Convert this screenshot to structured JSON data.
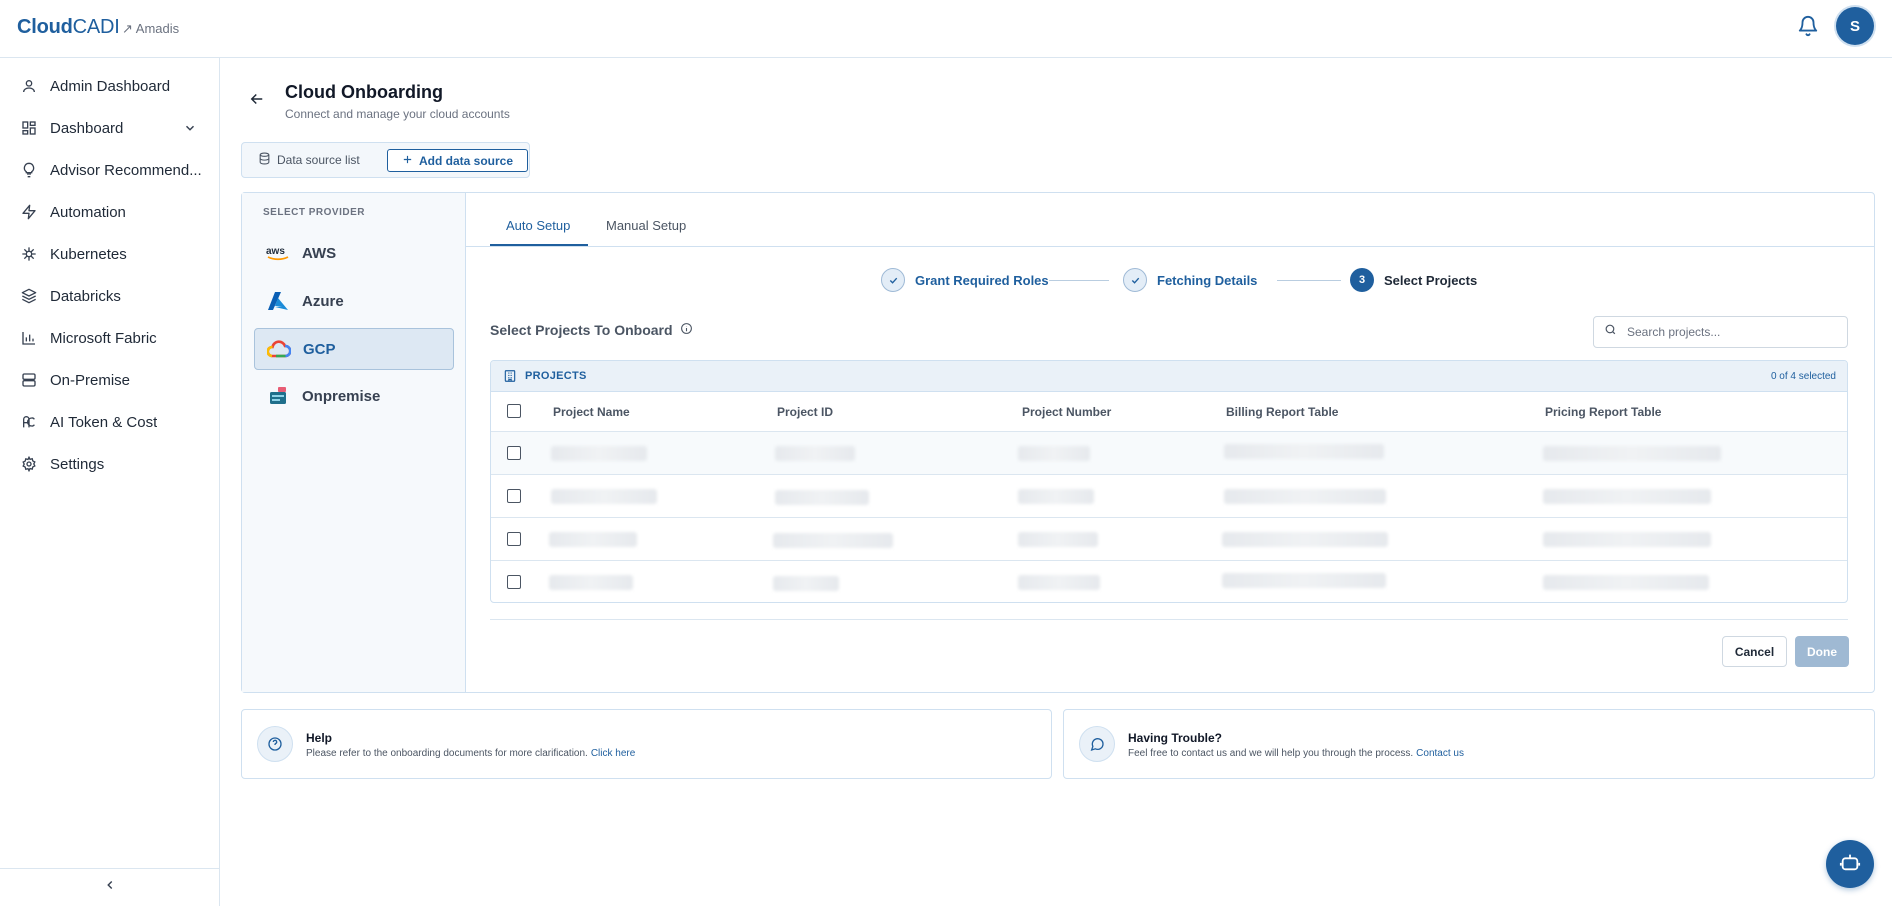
{
  "brand": {
    "logo_bold": "Cloud",
    "logo_rest": "CADI",
    "org": "↗ Amadis",
    "avatar_initial": "S",
    "accent": "#1f5f9e"
  },
  "sidebar": {
    "items": [
      {
        "label": "Admin Dashboard",
        "icon": "user-icon"
      },
      {
        "label": "Dashboard",
        "icon": "grid-icon"
      },
      {
        "label": "Advisor Recommend...",
        "icon": "lightbulb-icon"
      },
      {
        "label": "Automation",
        "icon": "bolt-icon"
      },
      {
        "label": "Kubernetes",
        "icon": "helm-icon"
      },
      {
        "label": "Databricks",
        "icon": "layers-icon"
      },
      {
        "label": "Microsoft Fabric",
        "icon": "bar-chart-icon"
      },
      {
        "label": "On-Premise",
        "icon": "server-icon"
      },
      {
        "label": "AI Token & Cost",
        "icon": "ai-cost-icon"
      },
      {
        "label": "Settings",
        "icon": "gear-icon"
      }
    ]
  },
  "header": {
    "title": "Cloud Onboarding",
    "subtitle": "Connect and manage your cloud accounts"
  },
  "datasource": {
    "list_label": "Data source list",
    "add_label": "Add data source"
  },
  "providers": {
    "heading": "SELECT PROVIDER",
    "items": [
      {
        "label": "AWS"
      },
      {
        "label": "Azure"
      },
      {
        "label": "GCP",
        "active": true
      },
      {
        "label": "Onpremise"
      }
    ]
  },
  "tabs": [
    {
      "label": "Auto Setup",
      "active": true
    },
    {
      "label": "Manual Setup"
    }
  ],
  "stepper": [
    {
      "label": "Grant Required Roles",
      "state": "done"
    },
    {
      "label": "Fetching Details",
      "state": "done"
    },
    {
      "label": "Select Projects",
      "number": "3",
      "state": "current"
    }
  ],
  "select": {
    "title": "Select Projects To Onboard",
    "search_placeholder": "Search projects..."
  },
  "table": {
    "title": "PROJECTS",
    "count": "0 of 4 selected",
    "columns": [
      "Project Name",
      "Project ID",
      "Project Number",
      "Billing Report Table",
      "Pricing Report Table"
    ],
    "row_count": 4
  },
  "actions": {
    "cancel": "Cancel",
    "done": "Done"
  },
  "help": {
    "title": "Help",
    "desc": "Please refer to the onboarding documents for more clarification.",
    "link": "Click here"
  },
  "trouble": {
    "title": "Having Trouble?",
    "desc": "Feel free to contact us and we will help you through the process.",
    "link": "Contact us"
  }
}
